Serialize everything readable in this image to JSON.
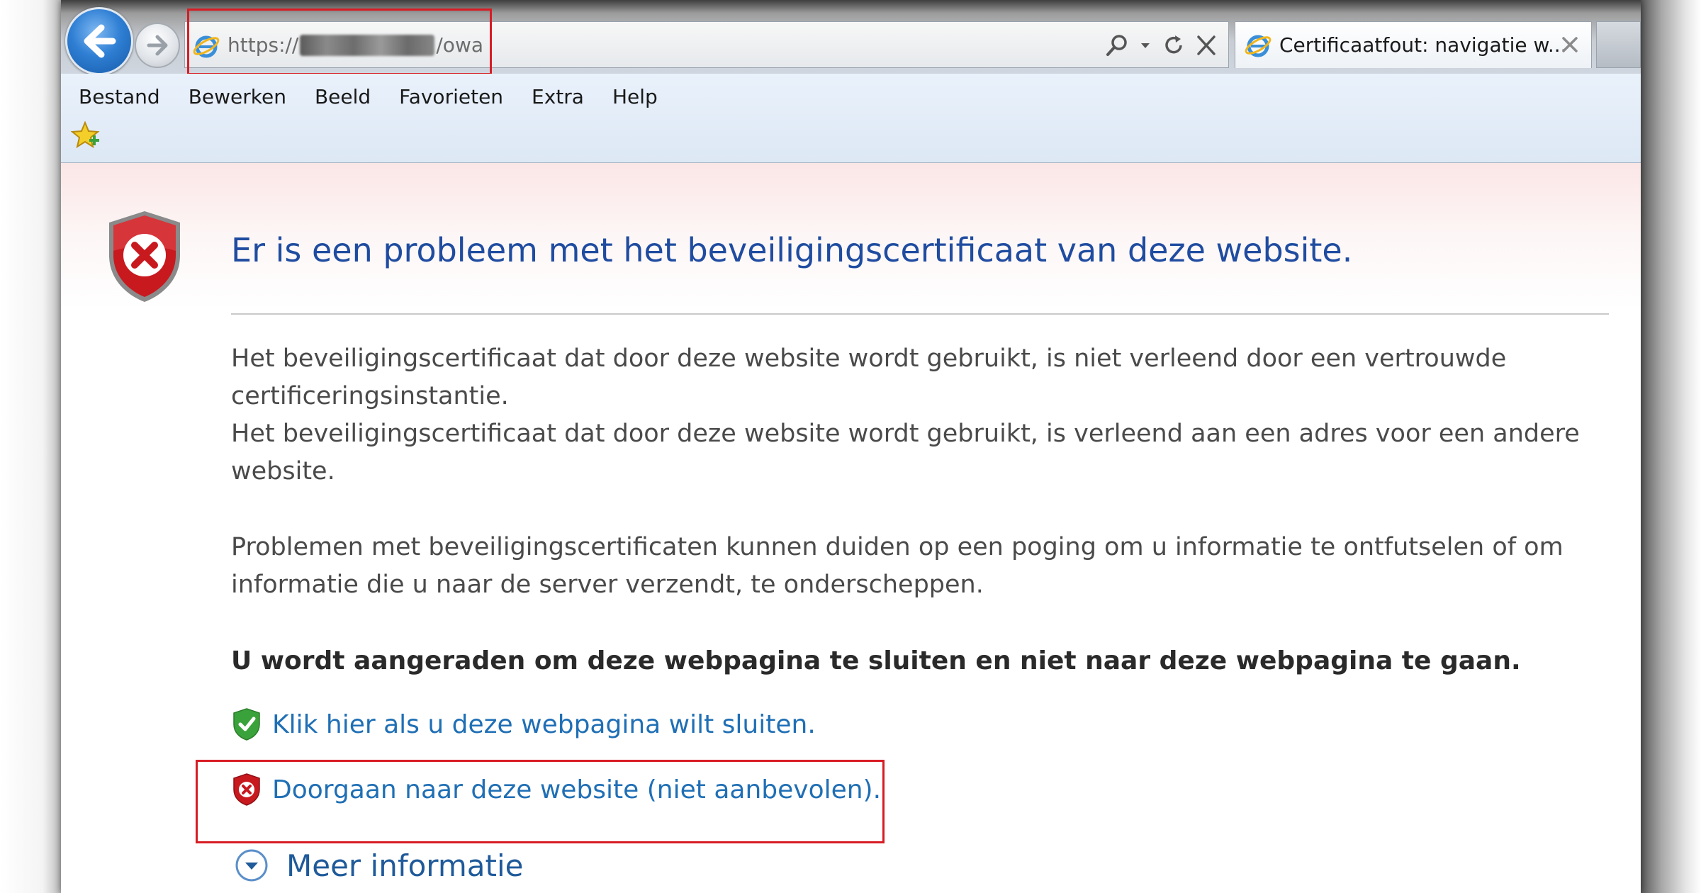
{
  "browser": {
    "address": {
      "url_prefix": "https://",
      "url_suffix": "/owa"
    },
    "tab": {
      "title": "Certificaatfout: navigatie w..."
    },
    "menu": [
      "Bestand",
      "Bewerken",
      "Beeld",
      "Favorieten",
      "Extra",
      "Help"
    ]
  },
  "page": {
    "title": "Er is een probleem met het beveiligingscertificaat van deze website.",
    "paragraph_1": "Het beveiligingscertificaat dat door deze website wordt gebruikt, is niet verleend door een vertrouwde certificeringsinstantie.",
    "paragraph_2": "Het beveiligingscertificaat dat door deze website wordt gebruikt, is verleend aan een adres voor een andere website.",
    "paragraph_3": "Problemen met beveiligingscertificaten kunnen duiden op een poging om u informatie te ontfutselen of om informatie die u naar de server verzendt, te onderscheppen.",
    "warning": "U wordt aangeraden om deze webpagina te sluiten en niet naar deze webpagina te gaan.",
    "close_link": "Klik hier als u deze webpagina wilt sluiten.",
    "continue_link": "Doorgaan naar deze website (niet aanbevolen).",
    "more_info": "Meer informatie"
  },
  "colors": {
    "title_blue": "#1f4ca0",
    "link_blue": "#1f6fb5",
    "highlight_red": "#d81c24",
    "shield_red": "#c8191f",
    "shield_green": "#3aa23a"
  }
}
